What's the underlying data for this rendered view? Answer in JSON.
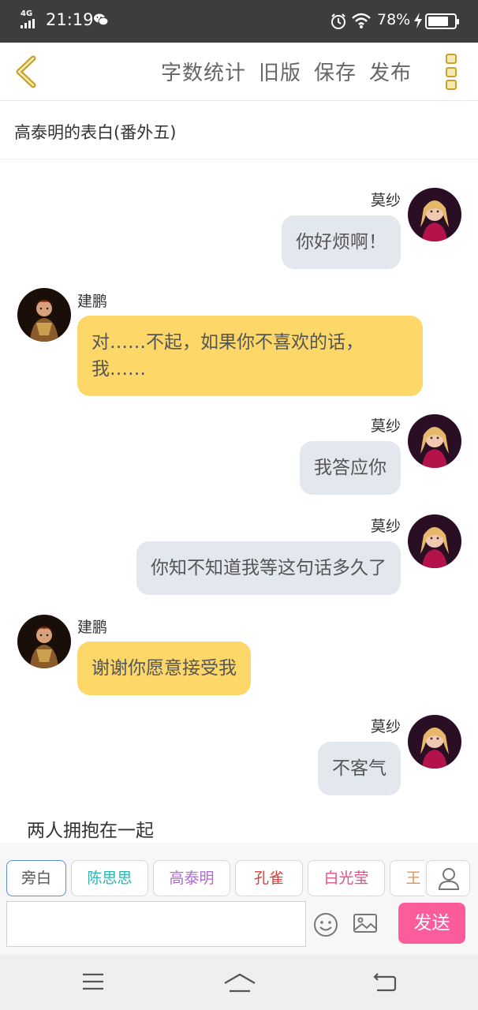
{
  "status_bar": {
    "network": "4G",
    "time": "21:19",
    "battery_percent": "78%",
    "battery_level": 0.78
  },
  "toolbar": {
    "actions": [
      "字数统计",
      "旧版",
      "保存",
      "发布"
    ]
  },
  "story_title": "高泰明的表白(番外五)",
  "messages": [
    {
      "speaker": "莫纱",
      "side": "right",
      "text": "你好烦啊！"
    },
    {
      "speaker": "建鹏",
      "side": "left",
      "text": "对……不起，如果你不喜欢的话，我……"
    },
    {
      "speaker": "莫纱",
      "side": "right",
      "text": "我答应你"
    },
    {
      "speaker": "莫纱",
      "side": "right",
      "text": "你知不知道我等这句话多久了"
    },
    {
      "speaker": "建鹏",
      "side": "left",
      "text": "谢谢你愿意接受我"
    },
    {
      "speaker": "莫纱",
      "side": "right",
      "text": "不客气"
    }
  ],
  "narration": "两人拥抱在一起",
  "characters": [
    {
      "label": "旁白",
      "color": "#555555"
    },
    {
      "label": "陈思思",
      "color": "#2bb5b0"
    },
    {
      "label": "高泰明",
      "color": "#b06ad0"
    },
    {
      "label": "孔雀",
      "color": "#d8413b"
    },
    {
      "label": "白光莹",
      "color": "#e0508a"
    },
    {
      "label": "王",
      "color": "#e8934a"
    }
  ],
  "input": {
    "placeholder": ""
  },
  "send_label": "发送",
  "colors": {
    "right_bubble": "#e3e8ee",
    "left_bubble": "#fdd768",
    "send_button": "#fc5c9c",
    "accent": "#c9a227"
  }
}
